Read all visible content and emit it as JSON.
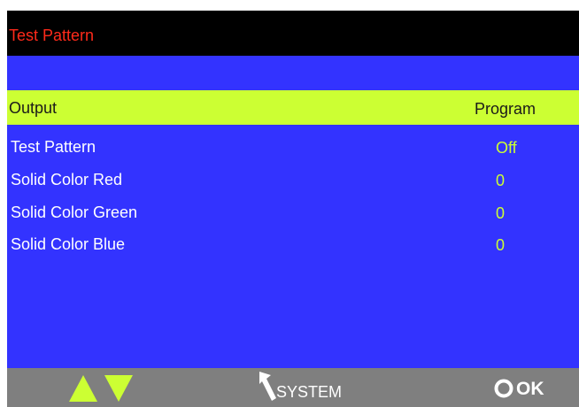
{
  "title": "Test Pattern",
  "colors": {
    "background": "#3333ff",
    "title_bar": "#000000",
    "title_text": "#ff2a1a",
    "highlight": "#ccff33",
    "value_text": "#ccff33",
    "bottom_bar": "#7f7f7f"
  },
  "selected_row": {
    "label": "Output",
    "value": "Program"
  },
  "menu_items": [
    {
      "label": "Test Pattern",
      "value": "Off"
    },
    {
      "label": "Solid Color Red",
      "value": "0"
    },
    {
      "label": "Solid Color Green",
      "value": "0"
    },
    {
      "label": "Solid Color Blue",
      "value": "0"
    }
  ],
  "footer": {
    "up_icon": "triangle-up-icon",
    "down_icon": "triangle-down-icon",
    "back_icon": "back-arrow-icon",
    "back_label": "SYSTEM",
    "ok_icon": "ok-ring-icon",
    "ok_label": "OK"
  }
}
